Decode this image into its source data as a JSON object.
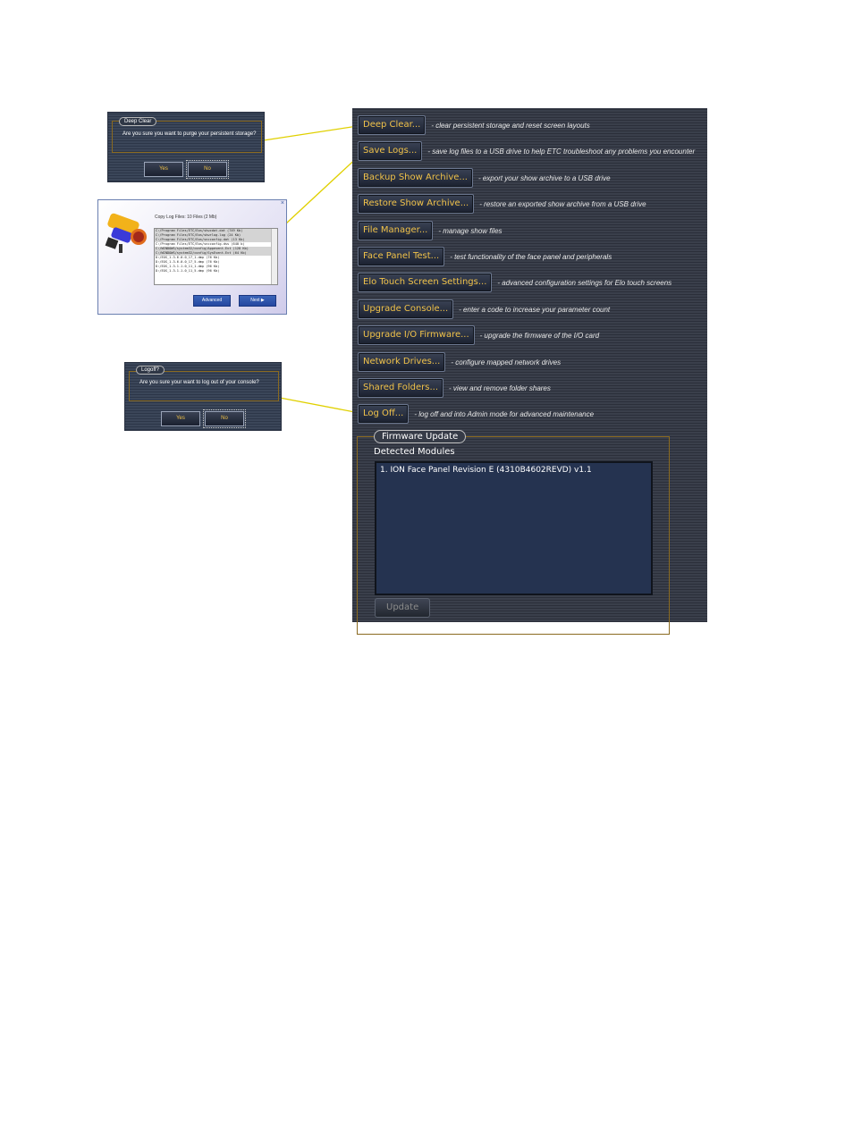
{
  "main_panel": {
    "rows": [
      {
        "button": "Deep Clear...",
        "desc": "- clear persistent storage and reset screen layouts"
      },
      {
        "button": "Save Logs...",
        "desc": "- save log files to a USB drive to help ETC troubleshoot any problems you encounter"
      },
      {
        "button": "Backup Show Archive...",
        "desc": "- export your show archive to a USB drive"
      },
      {
        "button": "Restore Show Archive...",
        "desc": "- restore an exported show archive from a USB drive"
      },
      {
        "button": "File Manager...",
        "desc": "- manage show files"
      },
      {
        "button": "Face Panel Test...",
        "desc": "- test functionality of the face panel and peripherals"
      },
      {
        "button": "Elo Touch Screen Settings...",
        "desc": "- advanced configuration settings for Elo touch screens"
      },
      {
        "button": "Upgrade Console...",
        "desc": "- enter a code to increase your parameter count"
      },
      {
        "button": "Upgrade I/O Firmware...",
        "desc": "- upgrade the firmware of the I/O card"
      },
      {
        "button": "Network Drives...",
        "desc": "- configure mapped network drives"
      },
      {
        "button": "Shared Folders...",
        "desc": "- view and remove folder shares"
      },
      {
        "button": "Log Off...",
        "desc": "- log off and into Admin mode for advanced maintenance"
      }
    ],
    "firmware": {
      "title": "Firmware Update",
      "label": "Detected Modules",
      "modules": [
        "1. ION Face Panel Revision E (4310B4602REVD) v1.1"
      ],
      "update_button": "Update"
    }
  },
  "deep_clear_dialog": {
    "title": "Deep Clear",
    "message": "Are you sure you want to purge your persistent storage?",
    "yes": "Yes",
    "no": "No"
  },
  "logoff_dialog": {
    "title": "Logoff?",
    "message": "Are you sure your want to log out of your console?",
    "yes": "Yes",
    "no": "No"
  },
  "copy_logs_dialog": {
    "title": "Copy Log Files: 10 Files (2 Mb)",
    "close": "×",
    "files": [
      "C:/Program Files/ETC/Eos/shwcdat.dat (749 Kb)",
      "C:/Program Files/ETC/Eos/shwrlog.log (24 Kb)",
      "C:/Program Files/ETC/Eos/vncconfig.dat (13 Kb)",
      "C:/Program Files/ETC/Eos/vncconfig.dss (640 b)",
      "C:/WINDOWS/system32/config/Appevent.Evt (128 Kb)",
      "C:/WINDOWS/system32/config/SysEvent.Evt (64 Kb)",
      "D:/EOS_1.3.6.0.0_17_1.dmp (76 Kb)",
      "D:/EOS_1.3.6.0.0_17_5.dmp (76 Kb)",
      "D:/EOS_1.3.1.1.0_11_1.dmp (96 Kb)",
      "D:/EOS_1.3.1.1.0_11_5.dmp (96 Kb)"
    ],
    "advanced": "Advanced",
    "next": "Next"
  },
  "colors": {
    "button_text": "#f0c24a",
    "panel_bg": "#363b47",
    "module_list_bg": "#253350",
    "callout_line": "#e0d000"
  },
  "icons": [
    "lamp-fixture-icon",
    "close-icon",
    "next-arrow-icon"
  ]
}
